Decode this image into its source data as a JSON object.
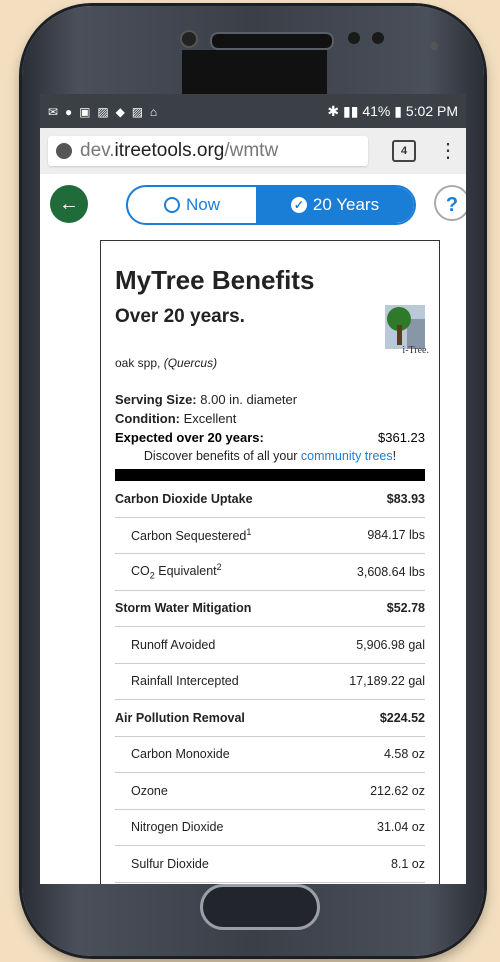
{
  "status_bar": {
    "left_icons": [
      "mail-icon",
      "messenger-icon",
      "image-icon",
      "photo-icon",
      "chat-icon",
      "photo-icon",
      "home-icon"
    ],
    "battery": "41%",
    "time": "5:02 PM"
  },
  "browser": {
    "url_host_prefix": "dev.",
    "url_domain": "itreetools.org",
    "url_path": "/wmtw",
    "tab_count": "4"
  },
  "toggle": {
    "now_label": "Now",
    "years_label": "20 Years"
  },
  "help_label": "?",
  "card": {
    "title": "MyTree Benefits",
    "subtitle": "Over 20 years.",
    "logo_text": "i-Tree.",
    "species_common": "oak spp,",
    "species_latin": "(Quercus)",
    "serving_label": "Serving Size:",
    "serving_value": "8.00 in. diameter",
    "condition_label": "Condition:",
    "condition_value": "Excellent",
    "expected_label": "Expected over 20 years:",
    "expected_value": "$361.23",
    "discover_prefix": "Discover benefits of all your ",
    "discover_link": "community trees",
    "discover_suffix": "!"
  },
  "rows": [
    {
      "label": "Carbon Dioxide Uptake",
      "value": "$83.93"
    },
    {
      "label": "Carbon Sequestered",
      "sup": "1",
      "value": "984.17 lbs"
    },
    {
      "label_pre": "CO",
      "label_sub": "2",
      "label_post": " Equivalent",
      "sup": "2",
      "value": "3,608.64 lbs"
    },
    {
      "label": "Storm Water Mitigation",
      "value": "$52.78"
    },
    {
      "label": "Runoff Avoided",
      "value": "5,906.98 gal"
    },
    {
      "label": "Rainfall Intercepted",
      "value": "17,189.22 gal"
    },
    {
      "label": "Air Pollution Removal",
      "value": "$224.52"
    },
    {
      "label": "Carbon Monoxide",
      "value": "4.58 oz"
    },
    {
      "label": "Ozone",
      "value": "212.62 oz"
    },
    {
      "label": "Nitrogen Dioxide",
      "value": "31.04 oz"
    },
    {
      "label": "Sulfur Dioxide",
      "value": "8.1 oz"
    }
  ],
  "colors": {
    "accent": "#1a7ed6",
    "back_button": "#1f6b3a"
  }
}
